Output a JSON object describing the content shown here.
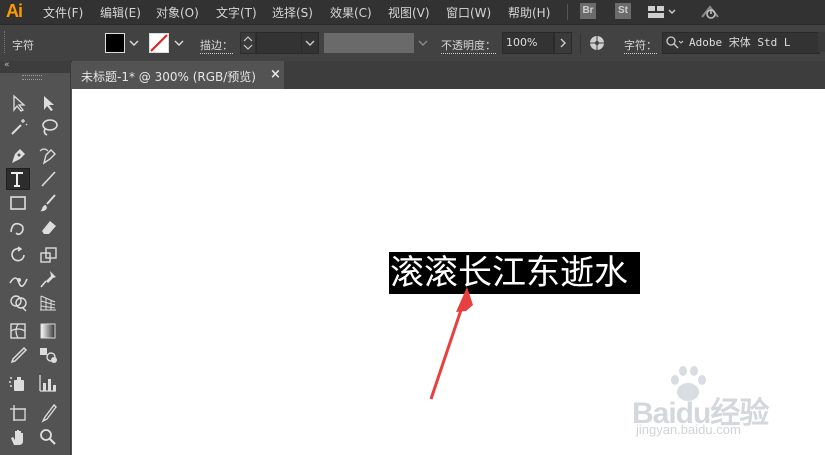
{
  "app": {
    "logo": "Ai"
  },
  "menu": {
    "items": [
      "文件(F)",
      "编辑(E)",
      "对象(O)",
      "文字(T)",
      "选择(S)",
      "效果(C)",
      "视图(V)",
      "窗口(W)",
      "帮助(H)"
    ],
    "icons": [
      "Br",
      "St"
    ]
  },
  "controlbar": {
    "panel_label": "字符",
    "stroke_label": "描边：",
    "opacity_label": "不透明度：",
    "opacity_value": "100%",
    "char_label": "字符：",
    "font_value": "Adobe 宋体 Std L"
  },
  "document": {
    "tab_title": "未标题-1* @ 300% (RGB/预览)",
    "close": "×"
  },
  "canvas": {
    "selected_text": "滚滚长江东逝水"
  },
  "watermark": {
    "brand": "Baidu经验",
    "url": "jingyan.baidu.com"
  },
  "colors": {
    "accent": "#ff9a00",
    "arrow": "#e8403f",
    "selection": "#000000"
  }
}
